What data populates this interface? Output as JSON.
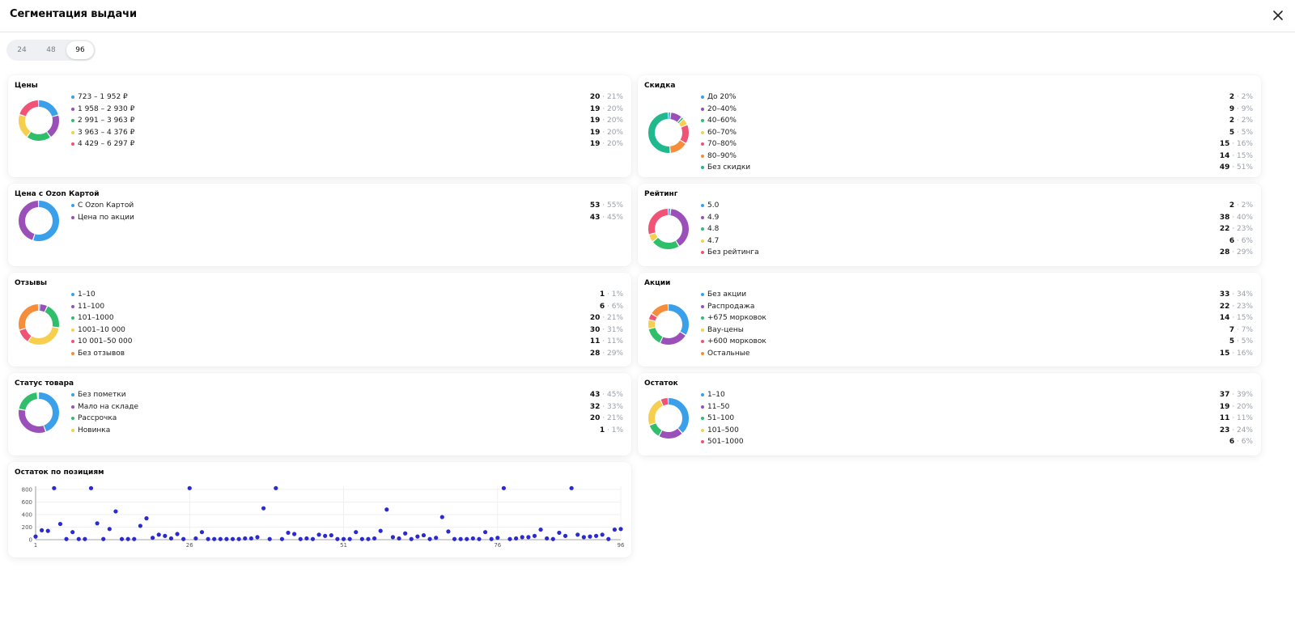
{
  "title": "Сегментация выдачи",
  "segment": {
    "options": [
      "24",
      "48",
      "96"
    ],
    "active": "96"
  },
  "cards": [
    {
      "id": "prices",
      "title": "Цены",
      "items": [
        {
          "label": "723 – 1 952 ₽",
          "count": "20",
          "pct": "21%",
          "color": "#3aa0ea"
        },
        {
          "label": "1 958 – 2 930 ₽",
          "count": "19",
          "pct": "20%",
          "color": "#9b4fb8"
        },
        {
          "label": "2 991 – 3 963 ₽",
          "count": "19",
          "pct": "20%",
          "color": "#2fbf6a"
        },
        {
          "label": "3 963 – 4 376 ₽",
          "count": "19",
          "pct": "20%",
          "color": "#f7cf4e"
        },
        {
          "label": "4 429 – 6 297 ₽",
          "count": "19",
          "pct": "20%",
          "color": "#f05375"
        }
      ]
    },
    {
      "id": "discount",
      "title": "Скидка",
      "items": [
        {
          "label": "До 20%",
          "count": "2",
          "pct": "2%",
          "color": "#3aa0ea"
        },
        {
          "label": "20–40%",
          "count": "9",
          "pct": "9%",
          "color": "#9b4fb8"
        },
        {
          "label": "40–60%",
          "count": "2",
          "pct": "2%",
          "color": "#2fbf6a"
        },
        {
          "label": "60–70%",
          "count": "5",
          "pct": "5%",
          "color": "#f7cf4e"
        },
        {
          "label": "70–80%",
          "count": "15",
          "pct": "16%",
          "color": "#f05375"
        },
        {
          "label": "80–90%",
          "count": "14",
          "pct": "15%",
          "color": "#f58d3b"
        },
        {
          "label": "Без скидки",
          "count": "49",
          "pct": "51%",
          "color": "#20b98d"
        }
      ]
    },
    {
      "id": "ozon-card",
      "title": "Цена с Ozon Картой",
      "items": [
        {
          "label": "С Ozon Картой",
          "count": "53",
          "pct": "55%",
          "color": "#3aa0ea"
        },
        {
          "label": "Цена по акции",
          "count": "43",
          "pct": "45%",
          "color": "#9b4fb8"
        }
      ]
    },
    {
      "id": "rating",
      "title": "Рейтинг",
      "items": [
        {
          "label": "5.0",
          "count": "2",
          "pct": "2%",
          "color": "#3aa0ea"
        },
        {
          "label": "4.9",
          "count": "38",
          "pct": "40%",
          "color": "#9b4fb8"
        },
        {
          "label": "4.8",
          "count": "22",
          "pct": "23%",
          "color": "#2fbf6a"
        },
        {
          "label": "4.7",
          "count": "6",
          "pct": "6%",
          "color": "#f7cf4e"
        },
        {
          "label": "Без рейтинга",
          "count": "28",
          "pct": "29%",
          "color": "#f05375"
        }
      ]
    },
    {
      "id": "reviews",
      "title": "Отзывы",
      "items": [
        {
          "label": "1–10",
          "count": "1",
          "pct": "1%",
          "color": "#3aa0ea"
        },
        {
          "label": "11–100",
          "count": "6",
          "pct": "6%",
          "color": "#9b4fb8"
        },
        {
          "label": "101–1000",
          "count": "20",
          "pct": "21%",
          "color": "#2fbf6a"
        },
        {
          "label": "1001–10 000",
          "count": "30",
          "pct": "31%",
          "color": "#f7cf4e"
        },
        {
          "label": "10 001–50 000",
          "count": "11",
          "pct": "11%",
          "color": "#f05375"
        },
        {
          "label": "Без отзывов",
          "count": "28",
          "pct": "29%",
          "color": "#f58d3b"
        }
      ]
    },
    {
      "id": "promos",
      "title": "Акции",
      "items": [
        {
          "label": "Без акции",
          "count": "33",
          "pct": "34%",
          "color": "#3aa0ea"
        },
        {
          "label": "Распродажа",
          "count": "22",
          "pct": "23%",
          "color": "#9b4fb8"
        },
        {
          "label": "+675 морковок",
          "count": "14",
          "pct": "15%",
          "color": "#2fbf6a"
        },
        {
          "label": "Вау-цены",
          "count": "7",
          "pct": "7%",
          "color": "#f7cf4e"
        },
        {
          "label": "+600 морковок",
          "count": "5",
          "pct": "5%",
          "color": "#f05375"
        },
        {
          "label": "Остальные",
          "count": "15",
          "pct": "16%",
          "color": "#f58d3b"
        }
      ]
    },
    {
      "id": "status",
      "title": "Статус товара",
      "items": [
        {
          "label": "Без пометки",
          "count": "43",
          "pct": "45%",
          "color": "#3aa0ea"
        },
        {
          "label": "Мало на складе",
          "count": "32",
          "pct": "33%",
          "color": "#9b4fb8"
        },
        {
          "label": "Рассрочка",
          "count": "20",
          "pct": "21%",
          "color": "#2fbf6a"
        },
        {
          "label": "Новинка",
          "count": "1",
          "pct": "1%",
          "color": "#f7cf4e"
        }
      ]
    },
    {
      "id": "stock",
      "title": "Остаток",
      "items": [
        {
          "label": "1–10",
          "count": "37",
          "pct": "39%",
          "color": "#3aa0ea"
        },
        {
          "label": "11–50",
          "count": "19",
          "pct": "20%",
          "color": "#9b4fb8"
        },
        {
          "label": "51–100",
          "count": "11",
          "pct": "11%",
          "color": "#2fbf6a"
        },
        {
          "label": "101–500",
          "count": "23",
          "pct": "24%",
          "color": "#f7cf4e"
        },
        {
          "label": "501–1000",
          "count": "6",
          "pct": "6%",
          "color": "#f05375"
        }
      ]
    }
  ],
  "scatter_card": {
    "title": "Остаток по позициям"
  },
  "chart_data": {
    "type": "scatter",
    "title": "Остаток по позициям",
    "xlabel": "",
    "ylabel": "",
    "xlim": [
      1,
      96
    ],
    "ylim": [
      0,
      850
    ],
    "xticks": [
      1,
      26,
      51,
      76,
      96
    ],
    "yticks": [
      0,
      200,
      400,
      600,
      800
    ],
    "grid": true,
    "point_color": "#2a2ad0",
    "x": [
      1,
      2,
      3,
      4,
      5,
      6,
      7,
      8,
      9,
      10,
      11,
      12,
      13,
      14,
      15,
      16,
      17,
      18,
      19,
      20,
      21,
      22,
      23,
      24,
      25,
      26,
      27,
      28,
      29,
      30,
      31,
      32,
      33,
      34,
      35,
      36,
      37,
      38,
      39,
      40,
      41,
      42,
      43,
      44,
      45,
      46,
      47,
      48,
      49,
      50,
      51,
      52,
      53,
      54,
      55,
      56,
      57,
      58,
      59,
      60,
      61,
      62,
      63,
      64,
      65,
      66,
      67,
      68,
      69,
      70,
      71,
      72,
      73,
      74,
      75,
      76,
      77,
      78,
      79,
      80,
      81,
      82,
      83,
      84,
      85,
      86,
      87,
      88,
      89,
      90,
      91,
      92,
      93,
      94,
      95,
      96
    ],
    "y": [
      50,
      150,
      140,
      820,
      250,
      10,
      120,
      10,
      10,
      820,
      260,
      10,
      170,
      450,
      10,
      10,
      10,
      220,
      340,
      30,
      80,
      60,
      20,
      90,
      10,
      820,
      20,
      120,
      10,
      10,
      10,
      10,
      10,
      10,
      20,
      20,
      40,
      500,
      10,
      820,
      10,
      110,
      90,
      10,
      20,
      10,
      80,
      60,
      70,
      10,
      10,
      10,
      120,
      10,
      10,
      20,
      140,
      480,
      40,
      20,
      100,
      10,
      50,
      70,
      10,
      30,
      360,
      130,
      10,
      10,
      10,
      20,
      10,
      120,
      10,
      30,
      820,
      10,
      20,
      40,
      40,
      60,
      160,
      20,
      10,
      110,
      60,
      820,
      80,
      40,
      50,
      60,
      80,
      10,
      160,
      170
    ]
  }
}
